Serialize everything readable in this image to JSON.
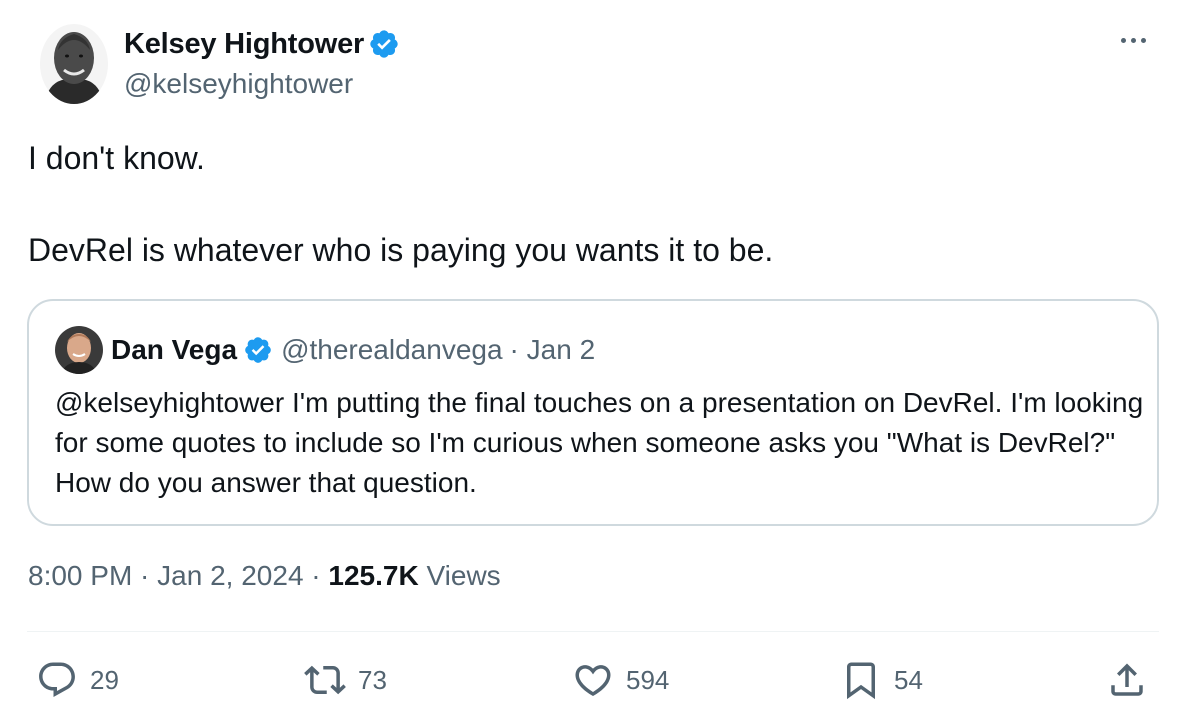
{
  "tweet": {
    "author": {
      "name": "Kelsey Hightower",
      "handle": "@kelseyhightower",
      "verified": true
    },
    "text_lines": [
      "I don't know.",
      "DevRel is whatever who is paying you wants it to be."
    ],
    "quoted": {
      "name": "Dan Vega",
      "handle": "@therealdanvega",
      "date": "· Jan 2",
      "text": "@kelseyhightower I'm putting the final touches on a presentation on DevRel. I'm looking for some quotes to include so I'm curious when someone asks you \"What is DevRel?\" How do you answer that question."
    },
    "time": "8:00 PM",
    "sep1": " · ",
    "date": "Jan 2, 2024",
    "sep2": " · ",
    "views_count": "125.7K",
    "views_label": " Views"
  },
  "actions": {
    "replies": "29",
    "reposts": "73",
    "likes": "594",
    "bookmarks": "54"
  },
  "icons": {
    "verified": "verified-badge-icon",
    "more": "more-icon",
    "reply": "reply-icon",
    "repost": "repost-icon",
    "like": "heart-icon",
    "bookmark": "bookmark-icon",
    "share": "share-icon"
  },
  "colors": {
    "verified_blue": "#1d9bf0",
    "secondary_text": "#536471",
    "primary_text": "#0f1419",
    "border": "#cfd9de"
  }
}
